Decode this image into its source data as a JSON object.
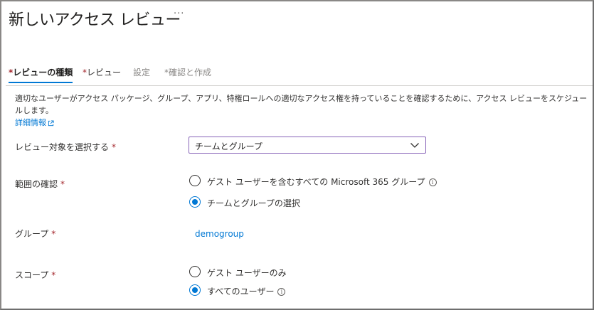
{
  "page": {
    "title": "新しいアクセス レビュー",
    "more_label": "···"
  },
  "tabs": [
    {
      "required_mark": "*",
      "label": "レビューの種類"
    },
    {
      "required_mark": "*",
      "label": "レビュー"
    },
    {
      "required_mark": "",
      "label": "設定"
    },
    {
      "required_mark": "*",
      "label": "確認と作成"
    }
  ],
  "description": {
    "text": "適切なユーザーがアクセス パッケージ、グループ、アプリ、特権ロールへの適切なアクセス権を持っていることを確認するために、アクセス レビューをスケジュールします。",
    "link_text": "詳細情報",
    "link_icon": "external-link-icon"
  },
  "form": {
    "required_mark": "*",
    "review_target": {
      "label": "レビュー対象を選択する",
      "value": "チームとグループ",
      "icon": "chevron-down-icon"
    },
    "scope_confirm": {
      "label": "範囲の確認",
      "options": [
        {
          "label": "ゲスト ユーザーを含むすべての Microsoft 365 グループ",
          "selected": false,
          "info": true
        },
        {
          "label": "チームとグループの選択",
          "selected": true,
          "info": false
        }
      ]
    },
    "group": {
      "label": "グループ",
      "value": "demogroup"
    },
    "scope": {
      "label": "スコープ",
      "options": [
        {
          "label": "ゲスト ユーザーのみ",
          "selected": false,
          "info": false
        },
        {
          "label": "すべてのユーザー",
          "selected": true,
          "info": true
        }
      ]
    }
  },
  "colors": {
    "accent": "#0078d4",
    "required": "#a4262c",
    "select_border": "#8764b8"
  }
}
